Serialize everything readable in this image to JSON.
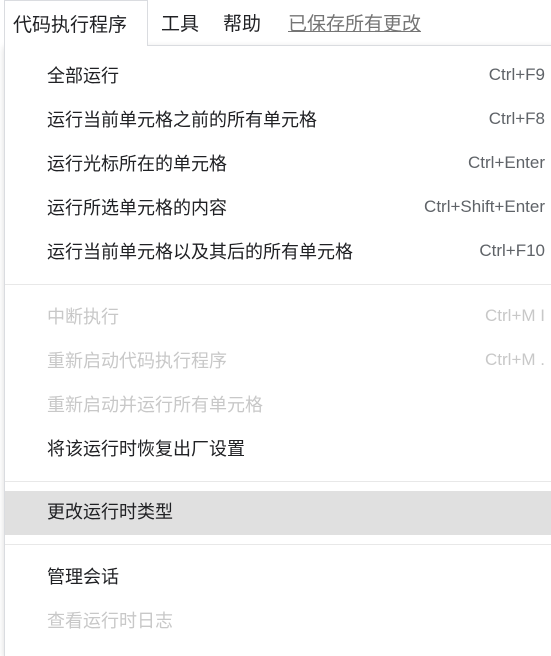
{
  "menubar": {
    "runtime": "代码执行程序",
    "tools": "工具",
    "help": "帮助",
    "saved_status": "已保存所有更改"
  },
  "menu": {
    "items": [
      {
        "label": "全部运行",
        "shortcut": "Ctrl+F9",
        "disabled": false
      },
      {
        "label": "运行当前单元格之前的所有单元格",
        "shortcut": "Ctrl+F8",
        "disabled": false
      },
      {
        "label": "运行光标所在的单元格",
        "shortcut": "Ctrl+Enter",
        "disabled": false
      },
      {
        "label": "运行所选单元格的内容",
        "shortcut": "Ctrl+Shift+Enter",
        "disabled": false
      },
      {
        "label": "运行当前单元格以及其后的所有单元格",
        "shortcut": "Ctrl+F10",
        "disabled": false
      },
      {
        "label": "中断执行",
        "shortcut": "Ctrl+M I",
        "disabled": true
      },
      {
        "label": "重新启动代码执行程序",
        "shortcut": "Ctrl+M .",
        "disabled": true
      },
      {
        "label": "重新启动并运行所有单元格",
        "shortcut": "",
        "disabled": true
      },
      {
        "label": "将该运行时恢复出厂设置",
        "shortcut": "",
        "disabled": false
      },
      {
        "label": "更改运行时类型",
        "shortcut": "",
        "disabled": false,
        "highlighted": true
      },
      {
        "label": "管理会话",
        "shortcut": "",
        "disabled": false
      },
      {
        "label": "查看运行时日志",
        "shortcut": "",
        "disabled": true
      }
    ]
  },
  "colors": {
    "text": "#202124",
    "disabled_text": "#c8c8c8",
    "highlight_bg": "#e0e0e0",
    "saved_status": "#757575"
  }
}
